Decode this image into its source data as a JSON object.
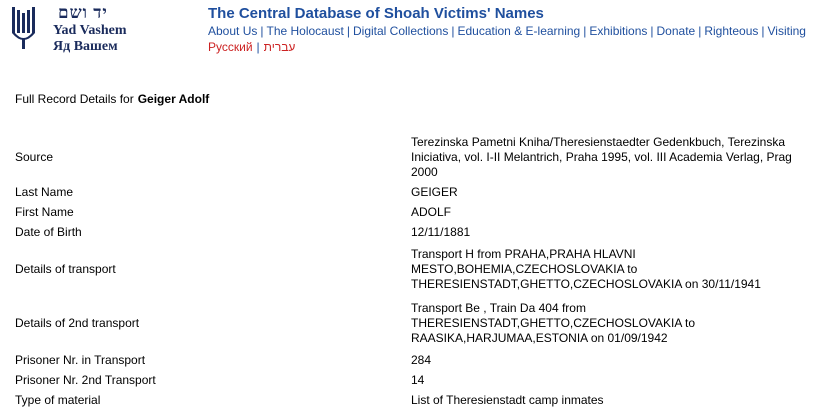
{
  "logo": {
    "hebrew": "יד ושם",
    "english": "Yad Vashem",
    "russian": "Яд Вашем"
  },
  "header": {
    "title": "The Central Database of Shoah Victims' Names",
    "nav": [
      "About Us",
      "The Holocaust",
      "Digital Collections",
      "Education & E-learning",
      "Exhibitions",
      "Donate",
      "Righteous",
      "Visiting"
    ],
    "langs": [
      "Русский",
      "עברית"
    ]
  },
  "record": {
    "heading_label": "Full Record Details for",
    "heading_name": "Geiger Adolf",
    "rows": [
      {
        "label": "Source",
        "value": "Terezinska Pametni Kniha/Theresienstaedter Gedenkbuch, Terezinska Iniciativa, vol. I-II Melantrich, Praha 1995, vol. III Academia Verlag, Prag 2000"
      },
      {
        "label": "Last Name",
        "value": "GEIGER"
      },
      {
        "label": "First Name",
        "value": "ADOLF"
      },
      {
        "label": "Date of Birth",
        "value": "12/11/1881"
      },
      {
        "label": "Details of transport",
        "value": "Transport H from PRAHA,PRAHA HLAVNI MESTO,BOHEMIA,CZECHOSLOVAKIA to THERESIENSTADT,GHETTO,CZECHOSLOVAKIA on 30/11/1941"
      },
      {
        "label": "Details of 2nd transport",
        "value": "Transport Be , Train Da 404 from THERESIENSTADT,GHETTO,CZECHOSLOVAKIA to RAASIKA,HARJUMAA,ESTONIA on 01/09/1942"
      },
      {
        "label": "Prisoner Nr. in Transport",
        "value": "284"
      },
      {
        "label": "Prisoner Nr. 2nd Transport",
        "value": "14"
      },
      {
        "label": "Type of material",
        "value": "List of Theresienstadt camp inmates"
      }
    ]
  }
}
